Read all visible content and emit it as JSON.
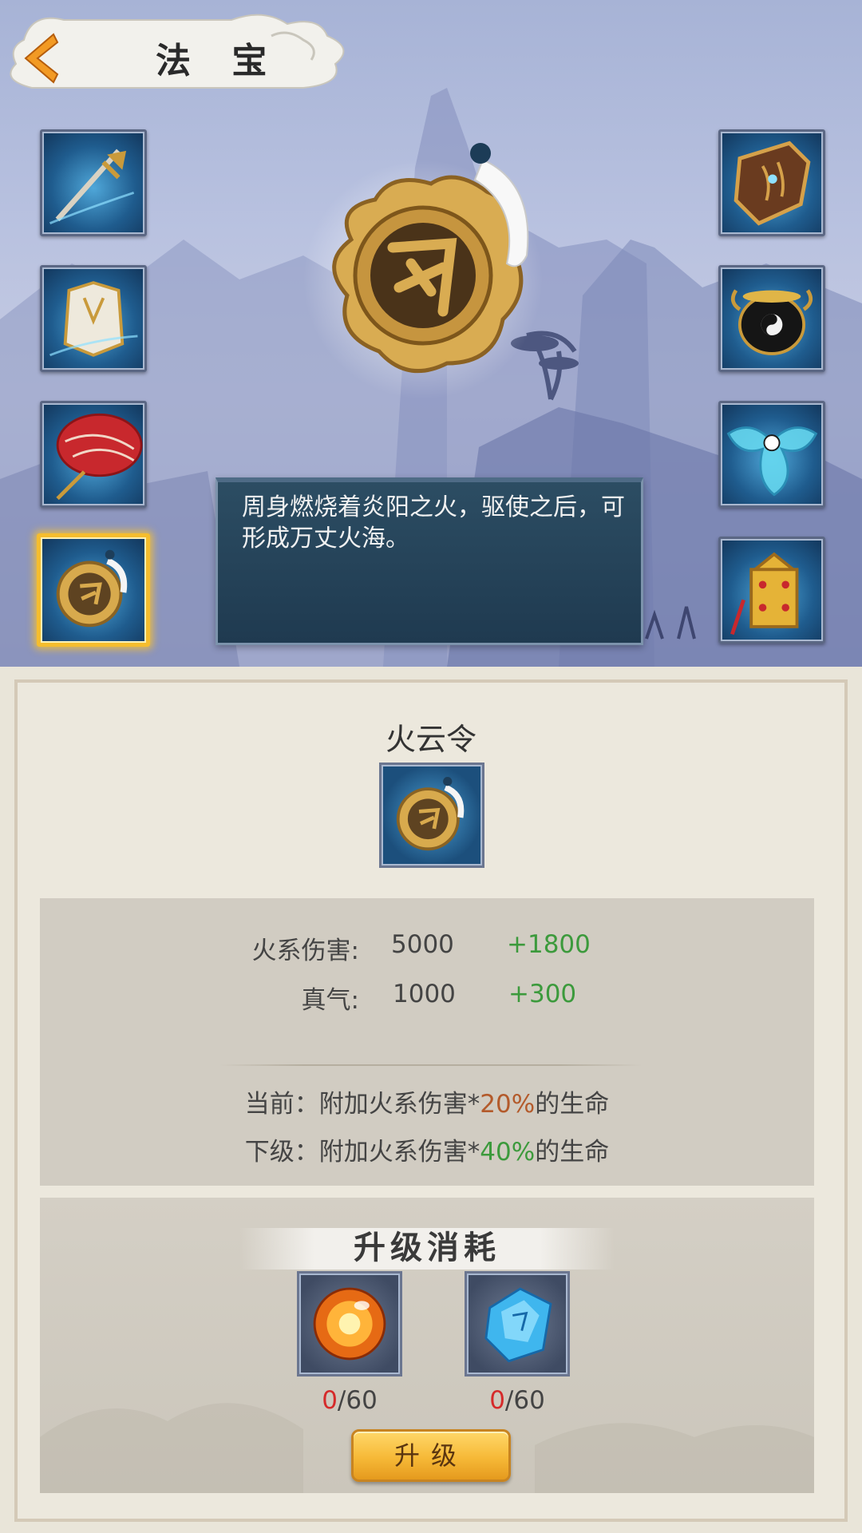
{
  "header": {
    "title": "法 宝"
  },
  "left_slots": [
    {
      "icon": "sword-icon"
    },
    {
      "icon": "armor-icon"
    },
    {
      "icon": "red-umbrella-icon"
    },
    {
      "icon": "fire-cloud-token-icon",
      "selected": true
    }
  ],
  "right_slots": [
    {
      "icon": "shield-icon"
    },
    {
      "icon": "yin-yang-cauldron-icon"
    },
    {
      "icon": "ribbon-icon"
    },
    {
      "icon": "golden-bell-icon"
    }
  ],
  "description": "周身燃烧着炎阳之火，驱使之后，可形成万丈火海。",
  "item": {
    "name": "火云令",
    "icon": "fire-cloud-token-icon"
  },
  "stats": [
    {
      "label": "火系伤害:",
      "value": "5000",
      "bonus": "+1800"
    },
    {
      "label": "真气:",
      "value": "1000",
      "bonus": "+300"
    }
  ],
  "effects": {
    "current_prefix": "当前：附加火系伤害*",
    "current_pct": "20%",
    "current_suffix": "的生命",
    "next_prefix": "下级：附加火系伤害*",
    "next_pct": "40%",
    "next_suffix": "的生命"
  },
  "upgrade_cost": {
    "title": "升级消耗",
    "materials": [
      {
        "icon": "fire-orb-icon",
        "have": "0",
        "need": "/60"
      },
      {
        "icon": "blue-crystal-icon",
        "have": "0",
        "need": "/60"
      }
    ],
    "button_label": "升级"
  },
  "colors": {
    "selected_border": "#f5bd2e",
    "bonus_green": "#3c9a3c",
    "current_orange": "#b35a2b",
    "insufficient_red": "#d52a2a"
  }
}
